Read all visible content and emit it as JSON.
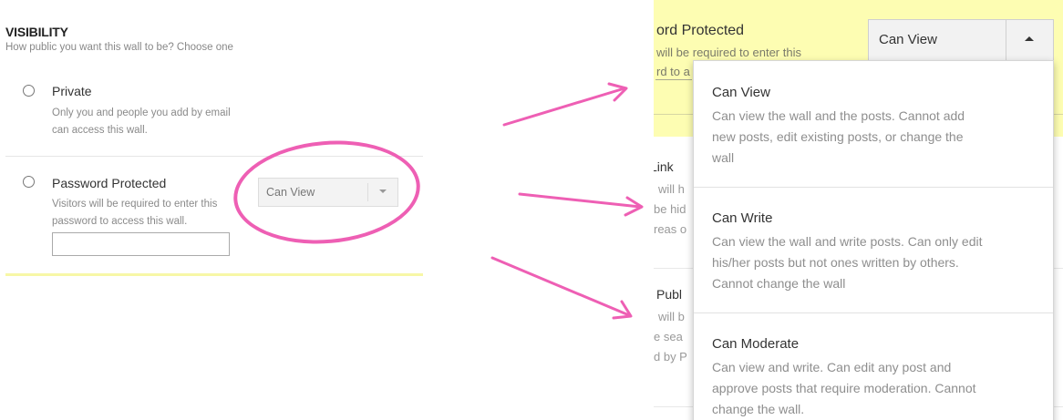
{
  "visibility": {
    "title": "VISIBILITY",
    "subtitle": "How public you want this wall to be? Choose one",
    "options": [
      {
        "label": "Private",
        "desc_lines": [
          "Only you and people you add by email",
          "can access this wall."
        ]
      },
      {
        "label": "Password Protected",
        "desc_lines": [
          "Visitors will be required to enter this",
          "password to access this wall."
        ],
        "password_value": ""
      }
    ],
    "permission_select": {
      "value": "Can View"
    }
  },
  "zoomed": {
    "option_title": "ord Protected",
    "option_desc_lines": [
      "will be required to enter this",
      "rd to a"
    ],
    "background_texts": {
      "link_title": "Link",
      "link_lines": [
        "will h",
        "be hid",
        "reas o"
      ],
      "public_title": "Publ",
      "public_lines": [
        "will b",
        "e sea",
        "d by P"
      ]
    },
    "permission_select": {
      "value": "Can View"
    },
    "dropdown_items": [
      {
        "title": "Can View",
        "desc_lines": [
          "Can view the wall and the posts. Cannot add",
          "new posts, edit existing posts, or change the",
          "wall"
        ]
      },
      {
        "title": "Can Write",
        "desc_lines": [
          "Can view the wall and write posts. Can only edit",
          "his/her posts but not ones written by others.",
          "Cannot change the wall"
        ]
      },
      {
        "title": "Can Moderate",
        "desc_lines": [
          "Can view and write. Can edit any post and",
          "approve posts that require moderation. Cannot",
          "change the wall."
        ]
      }
    ]
  },
  "annotation_color": "#ee5fb4",
  "highlight_color": "#fdfdb2"
}
